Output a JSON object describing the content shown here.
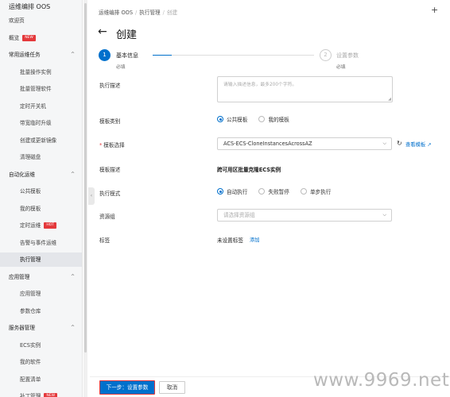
{
  "sidebar": {
    "title": "运维编排 OOS",
    "items": [
      {
        "label": "欢迎页",
        "kind": "top"
      },
      {
        "label": "概览",
        "kind": "top",
        "badge": "NEW"
      },
      {
        "label": "常用运维任务",
        "kind": "group",
        "chevron": "^"
      },
      {
        "label": "批量操作实例",
        "kind": "sub"
      },
      {
        "label": "批量管理软件",
        "kind": "sub"
      },
      {
        "label": "定时开关机",
        "kind": "sub"
      },
      {
        "label": "带宽临时升级",
        "kind": "sub"
      },
      {
        "label": "创建或更新镜像",
        "kind": "sub"
      },
      {
        "label": "清理磁盘",
        "kind": "sub"
      },
      {
        "label": "自动化运维",
        "kind": "group",
        "chevron": "^"
      },
      {
        "label": "公共模板",
        "kind": "sub"
      },
      {
        "label": "我的模板",
        "kind": "sub"
      },
      {
        "label": "定时运维",
        "kind": "sub",
        "badge": "HOT"
      },
      {
        "label": "告警与事件运维",
        "kind": "sub"
      },
      {
        "label": "执行管理",
        "kind": "sub",
        "active": true
      },
      {
        "label": "应用管理",
        "kind": "group",
        "chevron": "^"
      },
      {
        "label": "应用管理",
        "kind": "sub"
      },
      {
        "label": "参数仓库",
        "kind": "sub"
      },
      {
        "label": "服务器管理",
        "kind": "group",
        "chevron": "^"
      },
      {
        "label": "ECS实例",
        "kind": "sub"
      },
      {
        "label": "我的软件",
        "kind": "sub"
      },
      {
        "label": "配置清单",
        "kind": "sub"
      },
      {
        "label": "补丁管理",
        "kind": "sub",
        "badge": "NEW"
      }
    ]
  },
  "breadcrumb": [
    "运维编排 OOS",
    "执行管理",
    "创建"
  ],
  "header": {
    "back_icon": "←",
    "title": "创建",
    "plus_icon": "+"
  },
  "steps": [
    {
      "number": "1",
      "label": "基本信息",
      "sub": "必填",
      "state": "active"
    },
    {
      "number": "2",
      "label": "设置参数",
      "sub": "必填",
      "state": "pending"
    }
  ],
  "form": {
    "description": {
      "label": "执行描述",
      "placeholder": "请输入描述信息，最多200个字符。"
    },
    "template_category": {
      "label": "模板类别",
      "options": [
        "公共模板",
        "我的模板"
      ],
      "selected": 0
    },
    "template_select": {
      "label": "模板选择",
      "required": true,
      "value": "ACS-ECS-CloneInstancesAcrossAZ",
      "view_link": "查看模板"
    },
    "template_desc": {
      "label": "模板描述",
      "value": "跨可用区批量克隆ECS实例"
    },
    "exec_mode": {
      "label": "执行模式",
      "options": [
        "自动执行",
        "失败暂停",
        "单步执行"
      ],
      "selected": 0
    },
    "resource_group": {
      "label": "资源组",
      "placeholder": "请选择资源组"
    },
    "tags": {
      "label": "标签",
      "value": "未设置标签",
      "add_link": "添加"
    }
  },
  "footer": {
    "next_label": "下一步：设置参数",
    "cancel_label": "取消"
  },
  "watermark": "www.9969.net",
  "colors": {
    "accent": "#0070cc",
    "badge": "#e4393c"
  }
}
